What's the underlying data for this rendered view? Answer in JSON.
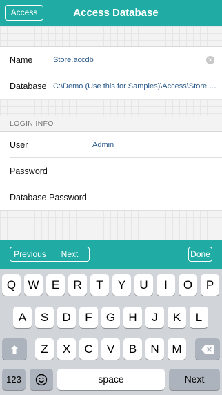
{
  "nav": {
    "back_label": "Access",
    "title": "Access Database"
  },
  "form": {
    "name": {
      "label": "Name",
      "value": "Store.accdb"
    },
    "database": {
      "label": "Database",
      "value": "C:\\Demo (Use this for Samples)\\Access\\Store.accdb"
    },
    "login_header": "LOGIN INFO",
    "user": {
      "label": "User",
      "value": "Admin"
    },
    "password": {
      "label": "Password",
      "value": ""
    },
    "db_password": {
      "label": "Database Password",
      "value": ""
    }
  },
  "accessory": {
    "previous_label": "Previous",
    "next_label": "Next",
    "done_label": "Done"
  },
  "keyboard": {
    "row1": [
      "Q",
      "W",
      "E",
      "R",
      "T",
      "Y",
      "U",
      "I",
      "O",
      "P"
    ],
    "row2": [
      "A",
      "S",
      "D",
      "F",
      "G",
      "H",
      "J",
      "K",
      "L"
    ],
    "row3": [
      "Z",
      "X",
      "C",
      "V",
      "B",
      "N",
      "M"
    ],
    "numbers_label": "123",
    "space_label": "space",
    "return_label": "Next",
    "shift_icon": "shift-icon",
    "delete_icon": "delete-icon",
    "emoji_icon": "emoji-icon"
  }
}
